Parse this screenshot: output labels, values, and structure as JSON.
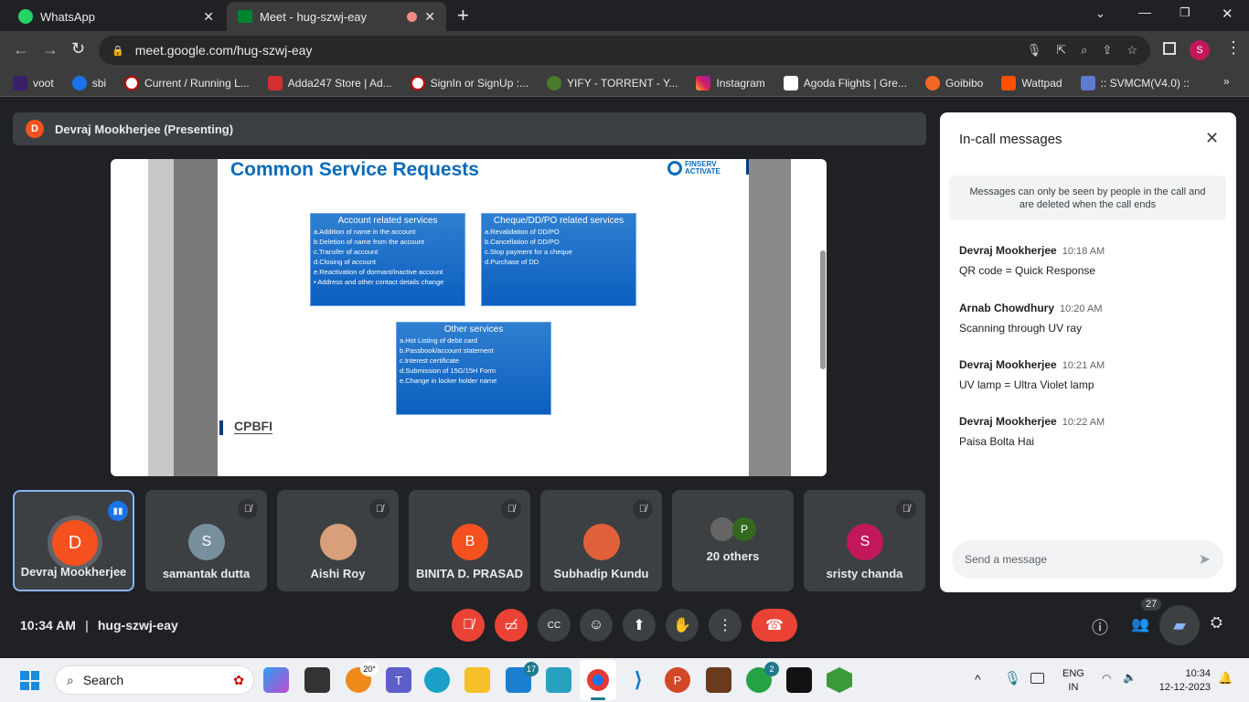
{
  "browser": {
    "tabs": [
      {
        "label": "WhatsApp"
      },
      {
        "label": "Meet - hug-szwj-eay"
      }
    ],
    "url": "meet.google.com/hug-szwj-eay",
    "profile_initial": "S",
    "bookmarks": [
      "voot",
      "sbi",
      "Current / Running L...",
      "Adda247 Store | Ad...",
      "SignIn or SignUp :...",
      "YIFY - TORRENT - Y...",
      "Instagram",
      "Agoda Flights | Gre...",
      "Goibibo",
      "Wattpad",
      ":: SVMCM(V4.0) ::"
    ]
  },
  "presenter": {
    "initial": "D",
    "label": "Devraj Mookherjee (Presenting)",
    "color": "#f4511e"
  },
  "slide": {
    "title": "Common Service Requests",
    "logo_line1": "FINSERV",
    "logo_line2": "ACTIVATE",
    "footer": "CPBFI",
    "boxes": [
      {
        "title": "Account related services",
        "items": [
          "a.Addition of name in the account",
          "b.Deletion of name from the account",
          "c.Transfer of account",
          "d.Closing of account",
          "e.Reactivation of dormant/inactive account",
          "• Address and other contact details change"
        ]
      },
      {
        "title": "Cheque/DD/PO related services",
        "items": [
          "a.Revalidation of DD/PO",
          "b.Cancellation of DD/PO",
          "c.Stop payment for a cheque",
          "d.Purchase of DD"
        ]
      },
      {
        "title": "Other services",
        "items": [
          "a.Hot Listing of debit card",
          "b.Passbook/account statement",
          "c.Interest certificate",
          "d.Submission of 15G/15H Form",
          "e.Change in locker holder name"
        ]
      }
    ]
  },
  "chat": {
    "title": "In-call messages",
    "notice": "Messages can only be seen by people in the call and are deleted when the call ends",
    "placeholder": "Send a message",
    "messages": [
      {
        "sender": "Devraj Mookherjee",
        "time": "10:18 AM",
        "text": "QR code = Quick Response"
      },
      {
        "sender": "Arnab Chowdhury",
        "time": "10:20 AM",
        "text": "Scanning through UV ray"
      },
      {
        "sender": "Devraj Mookherjee",
        "time": "10:21 AM",
        "text": "UV lamp = Ultra Violet lamp"
      },
      {
        "sender": "Devraj Mookherjee",
        "time": "10:22 AM",
        "text": "Paisa Bolta Hai"
      }
    ]
  },
  "participants": [
    {
      "name": "Devraj Mookherjee",
      "initial": "D",
      "color": "#f4511e"
    },
    {
      "name": "samantak dutta",
      "initial": "S",
      "color": "#78909c"
    },
    {
      "name": "Aishi Roy",
      "initial": "",
      "color": "#d8a07a"
    },
    {
      "name": "BINITA D. PRASAD",
      "initial": "B",
      "color": "#f4511e"
    },
    {
      "name": "Subhadip Kundu",
      "initial": "",
      "color": "#e0603a"
    },
    {
      "name": "20 others",
      "initial": "P",
      "color": "#33691e"
    },
    {
      "name": "sristy chanda",
      "initial": "S",
      "color": "#c2185b"
    }
  ],
  "bottom": {
    "time": "10:34 AM",
    "meeting_code": "hug-szwj-eay",
    "people_count": "27"
  },
  "taskbar": {
    "search": "Search",
    "weather": "20°",
    "mail_badge": "17",
    "whatsapp_badge": "2",
    "lang1": "ENG",
    "lang2": "IN",
    "time": "10:34",
    "date": "12-12-2023"
  }
}
